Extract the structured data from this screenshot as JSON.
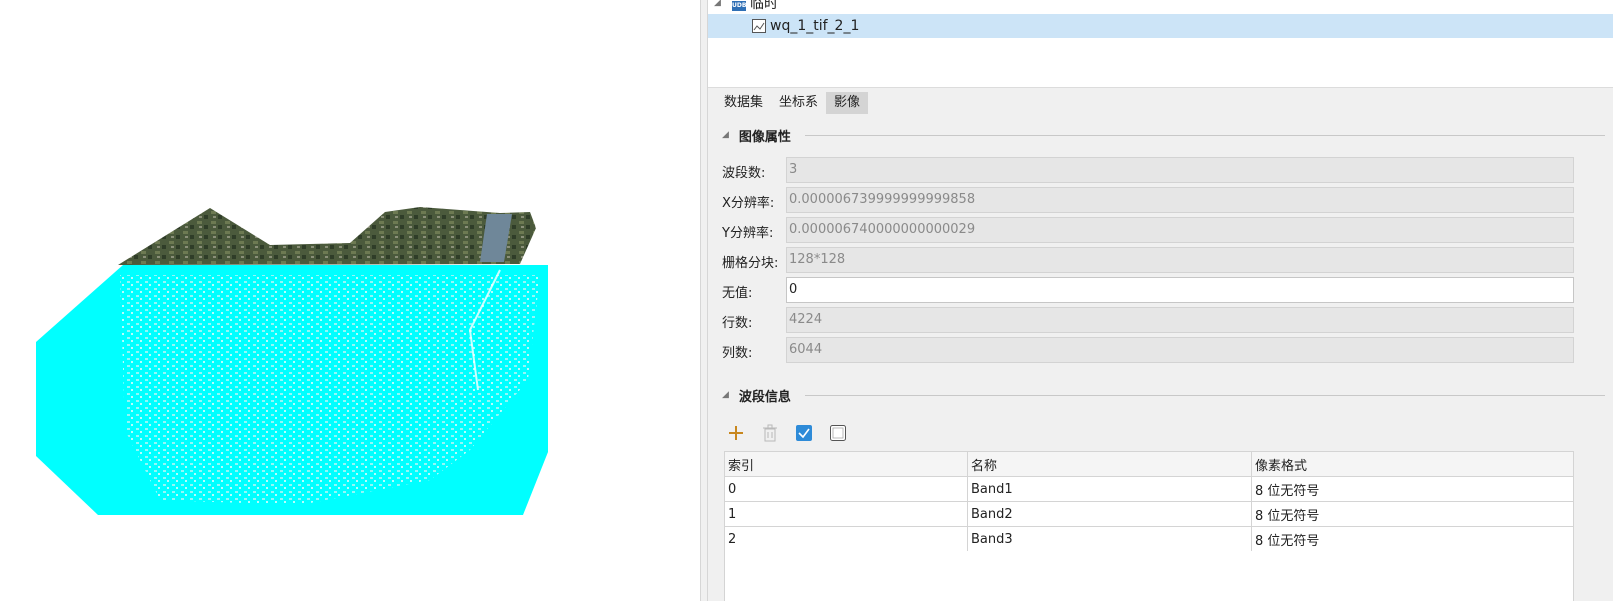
{
  "tree": {
    "datasource_label": "临时",
    "datasource_icon": "udbx-datasource-icon",
    "dataset_label": "wq_1_tif_2_1",
    "dataset_icon": "raster-dataset-icon"
  },
  "tabs": [
    {
      "label": "数据集"
    },
    {
      "label": "坐标系"
    },
    {
      "label": "影像",
      "active": true
    }
  ],
  "image_properties": {
    "section_title": "图像属性",
    "rows": [
      {
        "label": "波段数:",
        "value": "3"
      },
      {
        "label": "X分辨率:",
        "value": "0.000006739999999999858"
      },
      {
        "label": "Y分辨率:",
        "value": "0.000006740000000000029"
      },
      {
        "label": "栅格分块:",
        "value": "128*128"
      },
      {
        "label": "无值:",
        "value": "0"
      },
      {
        "label": "行数:",
        "value": "4224"
      },
      {
        "label": "列数:",
        "value": "6044"
      }
    ]
  },
  "band_info": {
    "section_title": "波段信息",
    "toolbar": {
      "add_icon": "plus-icon",
      "delete_icon": "trash-icon",
      "select_all_icon": "checkbox-checked-icon",
      "invert_icon": "checkbox-unchecked-icon"
    },
    "columns": [
      "索引",
      "名称",
      "像素格式"
    ],
    "rows": [
      {
        "index": "0",
        "name": "Band1",
        "format": "8 位无符号"
      },
      {
        "index": "1",
        "name": "Band2",
        "format": "8 位无符号"
      },
      {
        "index": "2",
        "name": "Band3",
        "format": "8 位无符号"
      }
    ]
  },
  "colors": {
    "nodata_fill": "#00ffff",
    "selection": "#cce4f7",
    "accent": "#2e8bd8"
  }
}
